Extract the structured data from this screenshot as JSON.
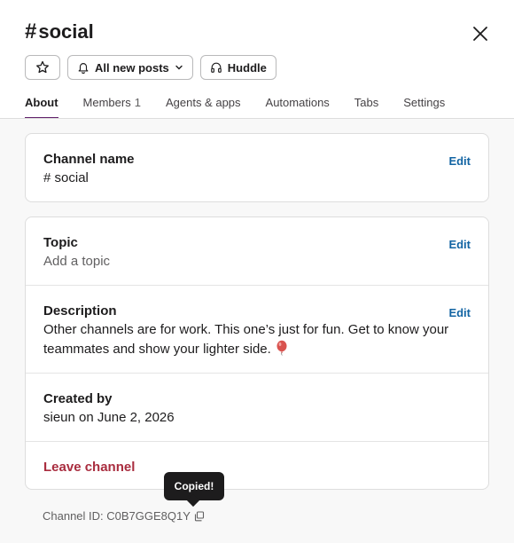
{
  "header": {
    "hash": "#",
    "channel_name": "social",
    "close_icon": "close-icon"
  },
  "actions": {
    "star_icon": "star-icon",
    "notifications_label": "All new posts",
    "huddle_label": "Huddle"
  },
  "tabs": [
    {
      "label": "About",
      "active": true
    },
    {
      "label": "Members",
      "count": "1"
    },
    {
      "label": "Agents & apps"
    },
    {
      "label": "Automations"
    },
    {
      "label": "Tabs"
    },
    {
      "label": "Settings"
    }
  ],
  "about": {
    "channel_name_label": "Channel name",
    "channel_name_value_hash": "#",
    "channel_name_value": "social",
    "edit_label": "Edit",
    "topic_label": "Topic",
    "topic_placeholder": "Add a topic",
    "description_label": "Description",
    "description_text": "Other channels are for work. This one’s just for fun. Get to know your teammates and show your lighter side.",
    "description_emoji": "balloon-emoji",
    "created_by_label": "Created by",
    "created_by_value": "sieun on June 2, 2026",
    "leave_label": "Leave channel"
  },
  "footer": {
    "tooltip": "Copied!",
    "channel_id": "Channel ID: C0B7GGE8Q1Y"
  },
  "colors": {
    "accent": "#611f69",
    "link": "#1264a3",
    "danger": "#a92d3f"
  }
}
